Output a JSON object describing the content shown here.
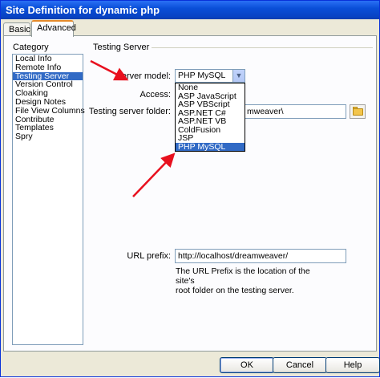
{
  "window": {
    "title": "Site Definition for dynamic php"
  },
  "tabs": [
    {
      "label": "Basic",
      "active": false
    },
    {
      "label": "Advanced",
      "active": true
    }
  ],
  "category": {
    "label": "Category",
    "items": [
      {
        "label": "Local Info",
        "selected": false
      },
      {
        "label": "Remote Info",
        "selected": false
      },
      {
        "label": "Testing Server",
        "selected": true
      },
      {
        "label": "Version Control",
        "selected": false
      },
      {
        "label": "Cloaking",
        "selected": false
      },
      {
        "label": "Design Notes",
        "selected": false
      },
      {
        "label": "File View Columns",
        "selected": false
      },
      {
        "label": "Contribute",
        "selected": false
      },
      {
        "label": "Templates",
        "selected": false
      },
      {
        "label": "Spry",
        "selected": false
      }
    ]
  },
  "section": {
    "title": "Testing Server"
  },
  "server_model": {
    "label": "Server model:",
    "value": "PHP MySQL",
    "options": [
      "None",
      "ASP JavaScript",
      "ASP VBScript",
      "ASP.NET C#",
      "ASP.NET VB",
      "ColdFusion",
      "JSP",
      "PHP MySQL"
    ],
    "highlighted": "PHP MySQL"
  },
  "access": {
    "label": "Access:"
  },
  "testing_folder": {
    "label": "Testing server folder:",
    "visible_value": "mweaver\\"
  },
  "url_prefix": {
    "label": "URL prefix:",
    "value": "http://localhost/dreamweaver/",
    "hint_line1": "The URL Prefix is the location of the site's",
    "hint_line2": "root folder on the testing server."
  },
  "buttons": {
    "ok": "OK",
    "cancel": "Cancel",
    "help": "Help"
  },
  "colors": {
    "annotation_arrow": "#e8101e",
    "selection": "#316ac5",
    "title_bar": "#0a4fd8"
  }
}
